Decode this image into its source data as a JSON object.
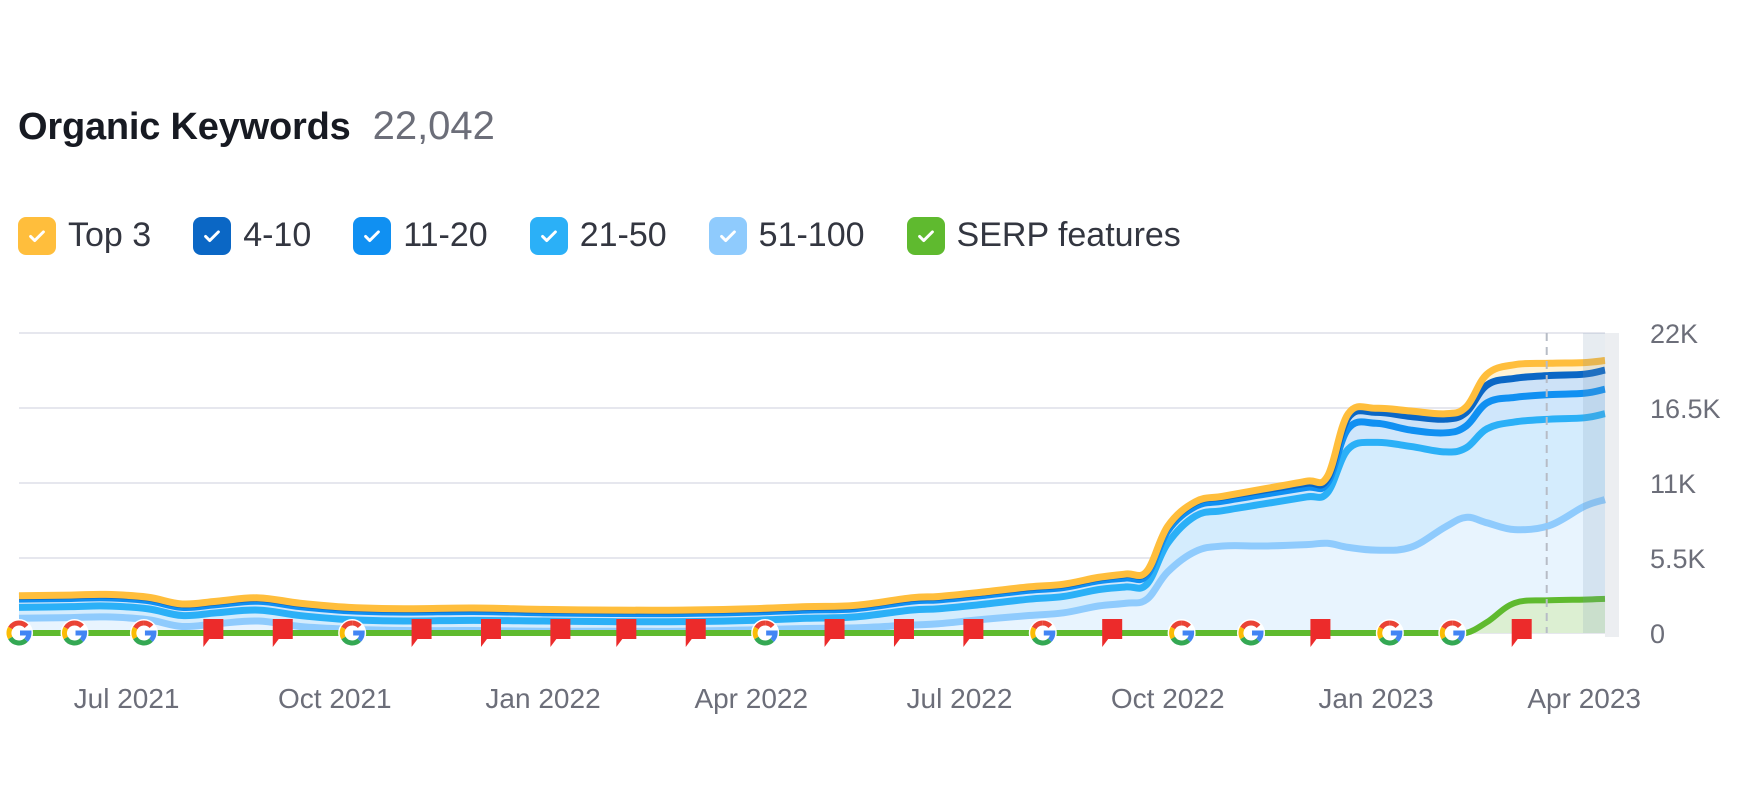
{
  "header": {
    "title": "Organic Keywords",
    "total": "22,042"
  },
  "legend": [
    {
      "label": "Top 3",
      "color": "#ffbe3c",
      "checked": true
    },
    {
      "label": "4-10",
      "color": "#0b67c5",
      "checked": true
    },
    {
      "label": "11-20",
      "color": "#1090f2",
      "checked": true
    },
    {
      "label": "21-50",
      "color": "#2bb0f7",
      "checked": true
    },
    {
      "label": "51-100",
      "color": "#8fcbfd",
      "checked": true
    },
    {
      "label": "SERP features",
      "color": "#5fba2f",
      "checked": true
    }
  ],
  "chart_data": {
    "type": "area",
    "title": "Organic Keywords",
    "stacked": true,
    "ylim": [
      0,
      22000
    ],
    "yticks": [
      0,
      5500,
      11000,
      16500,
      22000
    ],
    "ytick_labels": [
      "0",
      "5.5K",
      "11K",
      "16.5K",
      "22K"
    ],
    "xlim_months_from_2021_05": [
      0.45,
      23.3
    ],
    "xticks": [
      {
        "label": "Jul 2021",
        "month": 2
      },
      {
        "label": "Oct 2021",
        "month": 5
      },
      {
        "label": "Jan 2022",
        "month": 8
      },
      {
        "label": "Apr 2022",
        "month": 11
      },
      {
        "label": "Jul 2022",
        "month": 14
      },
      {
        "label": "Oct 2022",
        "month": 17
      },
      {
        "label": "Jan 2023",
        "month": 20
      },
      {
        "label": "Apr 2023",
        "month": 23
      }
    ],
    "x": [
      0.45,
      1.2,
      1.7,
      2.3,
      2.8,
      3.3,
      3.9,
      4.5,
      5.2,
      6,
      7,
      8,
      9,
      10,
      11,
      11.8,
      12.5,
      13.3,
      13.7,
      14.3,
      15,
      15.5,
      16.0,
      16.4,
      16.7,
      17.0,
      17.4,
      17.8,
      18.4,
      19.0,
      19.3,
      19.6,
      20.0,
      20.5,
      21.0,
      21.3,
      21.6,
      22.0,
      22.5,
      23.0,
      23.3
    ],
    "series": [
      {
        "name": "51-100",
        "color": "#8fcbfd",
        "values": [
          1300,
          1350,
          1400,
          1200,
          700,
          900,
          1100,
          700,
          500,
          400,
          400,
          350,
          350,
          350,
          450,
          550,
          600,
          800,
          900,
          1200,
          1500,
          1700,
          2200,
          2400,
          2700,
          4700,
          6200,
          6600,
          6600,
          6700,
          6800,
          6500,
          6300,
          6500,
          8000,
          8700,
          8300,
          7800,
          8100,
          9500,
          10000
        ]
      },
      {
        "name": "21-50",
        "color": "#2bb0f7",
        "values": [
          2100,
          2150,
          2200,
          2000,
          1500,
          1700,
          1900,
          1500,
          1200,
          1100,
          1150,
          1100,
          1050,
          1050,
          1150,
          1300,
          1400,
          1900,
          2000,
          2300,
          2700,
          2900,
          3400,
          3600,
          3800,
          6800,
          8800,
          9200,
          9700,
          10200,
          10500,
          13700,
          14200,
          13900,
          13500,
          13800,
          15200,
          15700,
          15900,
          16000,
          16300
        ]
      },
      {
        "name": "11-20",
        "color": "#1090f2",
        "values": [
          2700,
          2750,
          2800,
          2600,
          2100,
          2300,
          2550,
          2150,
          1850,
          1750,
          1800,
          1700,
          1650,
          1650,
          1750,
          1900,
          2000,
          2550,
          2650,
          2950,
          3350,
          3550,
          4050,
          4250,
          4450,
          7700,
          9500,
          9900,
          10400,
          10900,
          11200,
          15200,
          15600,
          15100,
          14900,
          15400,
          17100,
          17500,
          17700,
          17800,
          18100
        ]
      },
      {
        "name": "4-10",
        "color": "#0b67c5",
        "values": [
          2900,
          2950,
          3000,
          2800,
          2300,
          2500,
          2750,
          2350,
          2050,
          1950,
          2000,
          1900,
          1850,
          1850,
          1950,
          2100,
          2200,
          2750,
          2850,
          3150,
          3550,
          3750,
          4250,
          4500,
          4700,
          8000,
          9800,
          10200,
          10700,
          11200,
          11500,
          16000,
          16400,
          16100,
          15900,
          16400,
          18400,
          18900,
          19100,
          19200,
          19500
        ]
      },
      {
        "name": "Top 3",
        "color": "#ffbe3c",
        "values": [
          2950,
          3000,
          3050,
          2850,
          2350,
          2550,
          2800,
          2400,
          2100,
          2000,
          2050,
          1950,
          1900,
          1900,
          2000,
          2150,
          2250,
          2800,
          2900,
          3200,
          3600,
          3800,
          4300,
          4550,
          4750,
          8050,
          9850,
          10250,
          10800,
          11350,
          11700,
          16300,
          16700,
          16500,
          16300,
          16800,
          19200,
          19900,
          20000,
          20050,
          20200
        ]
      },
      {
        "name": "SERP features",
        "color": "#5fba2f",
        "values": [
          0,
          0,
          0,
          0,
          0,
          0,
          0,
          0,
          0,
          0,
          0,
          0,
          0,
          0,
          0,
          0,
          0,
          0,
          0,
          0,
          0,
          0,
          0,
          0,
          0,
          0,
          0,
          0,
          0,
          0,
          0,
          0,
          0,
          0,
          0,
          0,
          800,
          2200,
          2400,
          2450,
          2500
        ]
      }
    ],
    "series_note": "values are stacked upper boundaries (cumulative keyword counts)",
    "markers": [
      {
        "type": "google-update",
        "month": 0.45
      },
      {
        "type": "google-update",
        "month": 1.25
      },
      {
        "type": "google-update",
        "month": 2.25
      },
      {
        "type": "note-flag",
        "month": 3.25
      },
      {
        "type": "note-flag",
        "month": 4.25
      },
      {
        "type": "google-update",
        "month": 5.25
      },
      {
        "type": "note-flag",
        "month": 6.25
      },
      {
        "type": "note-flag",
        "month": 7.25
      },
      {
        "type": "note-flag",
        "month": 8.25
      },
      {
        "type": "note-flag",
        "month": 9.2
      },
      {
        "type": "note-flag",
        "month": 10.2
      },
      {
        "type": "google-update",
        "month": 11.2
      },
      {
        "type": "note-flag",
        "month": 12.2
      },
      {
        "type": "note-flag",
        "month": 13.2
      },
      {
        "type": "note-flag",
        "month": 14.2
      },
      {
        "type": "google-update",
        "month": 15.2
      },
      {
        "type": "note-flag",
        "month": 16.2
      },
      {
        "type": "google-update",
        "month": 17.2
      },
      {
        "type": "google-update",
        "month": 18.2
      },
      {
        "type": "note-flag",
        "month": 19.2
      },
      {
        "type": "google-update",
        "month": 20.2
      },
      {
        "type": "google-update",
        "month": 21.1
      },
      {
        "type": "note-flag",
        "month": 22.1
      }
    ],
    "current_date_marker_month": 22.1,
    "legend_placement": "top-left",
    "grid": true
  }
}
